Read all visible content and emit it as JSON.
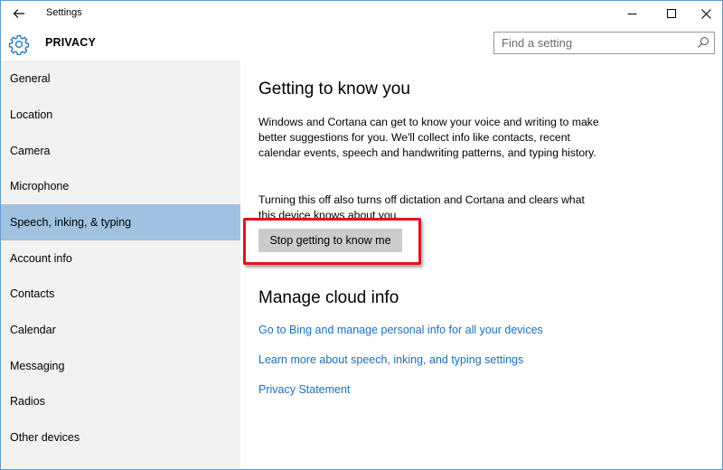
{
  "window": {
    "title": "Settings",
    "back_icon": "back-arrow-icon",
    "minimize_icon": "minimize-icon",
    "maximize_icon": "maximize-icon",
    "close_icon": "close-icon"
  },
  "header": {
    "icon": "gear-icon",
    "title": "PRIVACY",
    "search_placeholder": "Find a setting",
    "search_icon": "search-icon"
  },
  "sidebar": {
    "selected_index": 4,
    "items": [
      {
        "label": "General"
      },
      {
        "label": "Location"
      },
      {
        "label": "Camera"
      },
      {
        "label": "Microphone"
      },
      {
        "label": "Speech, inking, & typing"
      },
      {
        "label": "Account info"
      },
      {
        "label": "Contacts"
      },
      {
        "label": "Calendar"
      },
      {
        "label": "Messaging"
      },
      {
        "label": "Radios"
      },
      {
        "label": "Other devices"
      }
    ]
  },
  "main": {
    "section1_title": "Getting to know you",
    "paragraph1": "Windows and Cortana can get to know your voice and writing to make better suggestions for you. We'll collect info like contacts, recent calendar events, speech and handwriting patterns, and typing history.",
    "paragraph2": "Turning this off also turns off dictation and Cortana and clears what this device knows about you.",
    "stop_button_label": "Stop getting to know me",
    "section2_title": "Manage cloud info",
    "links": [
      "Go to Bing and manage personal info for all your devices",
      "Learn more about speech, inking, and typing settings",
      "Privacy Statement"
    ]
  },
  "colors": {
    "selected_nav": "#9ec2e0",
    "sidebar_bg": "#f2f2f2",
    "link": "#1a6fc0",
    "highlight_border": "#e0141b",
    "button_bg": "#cccccc"
  }
}
